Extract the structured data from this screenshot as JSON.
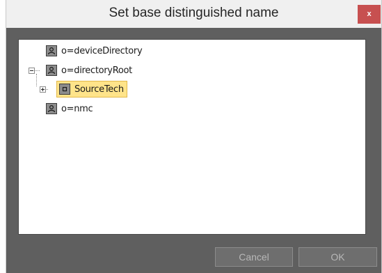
{
  "dialog": {
    "title": "Set base distinguished name",
    "close_label": "x"
  },
  "tree": {
    "nodes": [
      {
        "label": "o=deviceDirectory",
        "icon": "person-icon"
      },
      {
        "label": "o=directoryRoot",
        "icon": "person-icon",
        "expanded": true
      },
      {
        "label": "SourceTech",
        "icon": "unit-icon",
        "selected": true,
        "collapsed": true
      },
      {
        "label": "o=nmc",
        "icon": "person-icon"
      }
    ]
  },
  "buttons": {
    "cancel": "Cancel",
    "ok": "OK"
  },
  "colors": {
    "selection_bg": "#ffe48a",
    "close_bg": "#c75050",
    "panel_bg": "#5f5f5f"
  }
}
